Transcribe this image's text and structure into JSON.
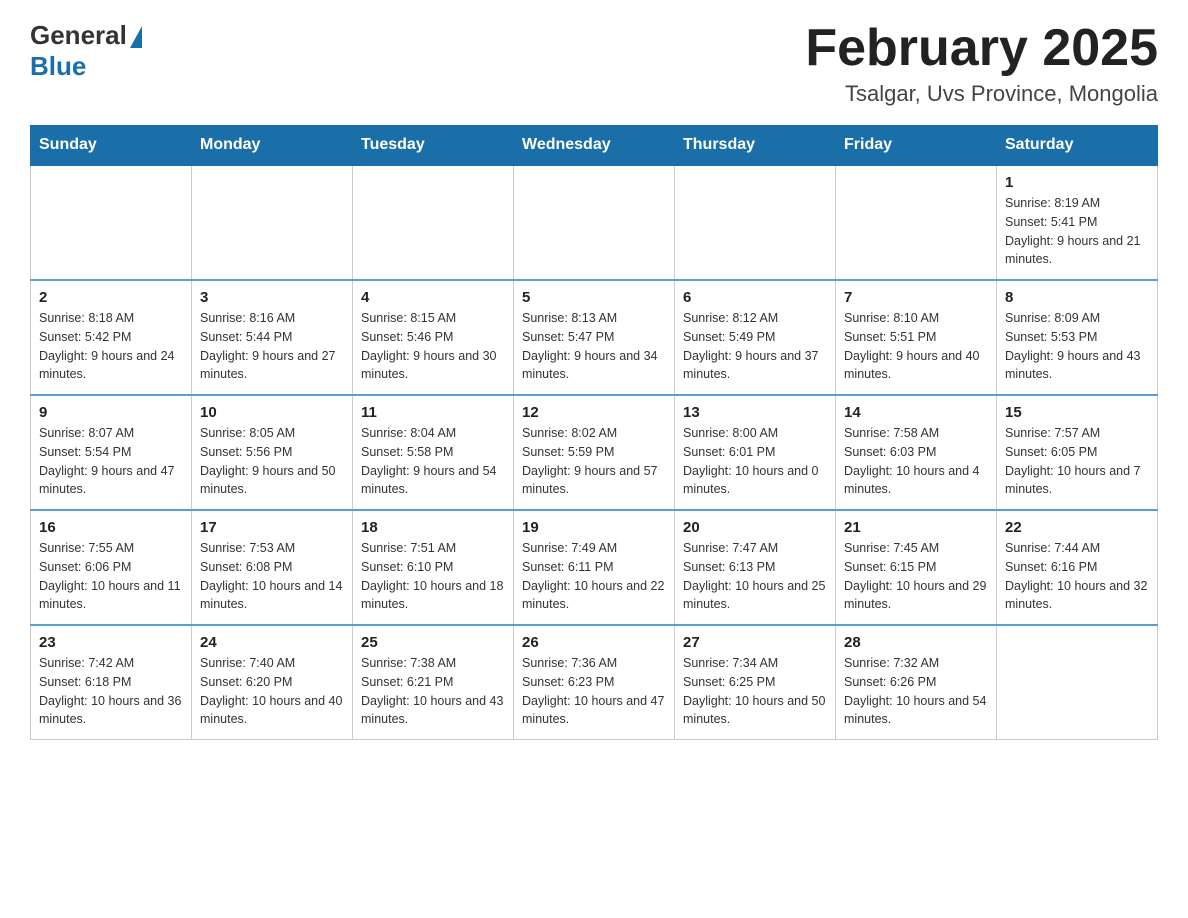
{
  "logo": {
    "general": "General",
    "blue": "Blue"
  },
  "title": {
    "month_year": "February 2025",
    "location": "Tsalgar, Uvs Province, Mongolia"
  },
  "weekdays": [
    "Sunday",
    "Monday",
    "Tuesday",
    "Wednesday",
    "Thursday",
    "Friday",
    "Saturday"
  ],
  "weeks": [
    [
      {
        "day": "",
        "sunrise": "",
        "sunset": "",
        "daylight": ""
      },
      {
        "day": "",
        "sunrise": "",
        "sunset": "",
        "daylight": ""
      },
      {
        "day": "",
        "sunrise": "",
        "sunset": "",
        "daylight": ""
      },
      {
        "day": "",
        "sunrise": "",
        "sunset": "",
        "daylight": ""
      },
      {
        "day": "",
        "sunrise": "",
        "sunset": "",
        "daylight": ""
      },
      {
        "day": "",
        "sunrise": "",
        "sunset": "",
        "daylight": ""
      },
      {
        "day": "1",
        "sunrise": "Sunrise: 8:19 AM",
        "sunset": "Sunset: 5:41 PM",
        "daylight": "Daylight: 9 hours and 21 minutes."
      }
    ],
    [
      {
        "day": "2",
        "sunrise": "Sunrise: 8:18 AM",
        "sunset": "Sunset: 5:42 PM",
        "daylight": "Daylight: 9 hours and 24 minutes."
      },
      {
        "day": "3",
        "sunrise": "Sunrise: 8:16 AM",
        "sunset": "Sunset: 5:44 PM",
        "daylight": "Daylight: 9 hours and 27 minutes."
      },
      {
        "day": "4",
        "sunrise": "Sunrise: 8:15 AM",
        "sunset": "Sunset: 5:46 PM",
        "daylight": "Daylight: 9 hours and 30 minutes."
      },
      {
        "day": "5",
        "sunrise": "Sunrise: 8:13 AM",
        "sunset": "Sunset: 5:47 PM",
        "daylight": "Daylight: 9 hours and 34 minutes."
      },
      {
        "day": "6",
        "sunrise": "Sunrise: 8:12 AM",
        "sunset": "Sunset: 5:49 PM",
        "daylight": "Daylight: 9 hours and 37 minutes."
      },
      {
        "day": "7",
        "sunrise": "Sunrise: 8:10 AM",
        "sunset": "Sunset: 5:51 PM",
        "daylight": "Daylight: 9 hours and 40 minutes."
      },
      {
        "day": "8",
        "sunrise": "Sunrise: 8:09 AM",
        "sunset": "Sunset: 5:53 PM",
        "daylight": "Daylight: 9 hours and 43 minutes."
      }
    ],
    [
      {
        "day": "9",
        "sunrise": "Sunrise: 8:07 AM",
        "sunset": "Sunset: 5:54 PM",
        "daylight": "Daylight: 9 hours and 47 minutes."
      },
      {
        "day": "10",
        "sunrise": "Sunrise: 8:05 AM",
        "sunset": "Sunset: 5:56 PM",
        "daylight": "Daylight: 9 hours and 50 minutes."
      },
      {
        "day": "11",
        "sunrise": "Sunrise: 8:04 AM",
        "sunset": "Sunset: 5:58 PM",
        "daylight": "Daylight: 9 hours and 54 minutes."
      },
      {
        "day": "12",
        "sunrise": "Sunrise: 8:02 AM",
        "sunset": "Sunset: 5:59 PM",
        "daylight": "Daylight: 9 hours and 57 minutes."
      },
      {
        "day": "13",
        "sunrise": "Sunrise: 8:00 AM",
        "sunset": "Sunset: 6:01 PM",
        "daylight": "Daylight: 10 hours and 0 minutes."
      },
      {
        "day": "14",
        "sunrise": "Sunrise: 7:58 AM",
        "sunset": "Sunset: 6:03 PM",
        "daylight": "Daylight: 10 hours and 4 minutes."
      },
      {
        "day": "15",
        "sunrise": "Sunrise: 7:57 AM",
        "sunset": "Sunset: 6:05 PM",
        "daylight": "Daylight: 10 hours and 7 minutes."
      }
    ],
    [
      {
        "day": "16",
        "sunrise": "Sunrise: 7:55 AM",
        "sunset": "Sunset: 6:06 PM",
        "daylight": "Daylight: 10 hours and 11 minutes."
      },
      {
        "day": "17",
        "sunrise": "Sunrise: 7:53 AM",
        "sunset": "Sunset: 6:08 PM",
        "daylight": "Daylight: 10 hours and 14 minutes."
      },
      {
        "day": "18",
        "sunrise": "Sunrise: 7:51 AM",
        "sunset": "Sunset: 6:10 PM",
        "daylight": "Daylight: 10 hours and 18 minutes."
      },
      {
        "day": "19",
        "sunrise": "Sunrise: 7:49 AM",
        "sunset": "Sunset: 6:11 PM",
        "daylight": "Daylight: 10 hours and 22 minutes."
      },
      {
        "day": "20",
        "sunrise": "Sunrise: 7:47 AM",
        "sunset": "Sunset: 6:13 PM",
        "daylight": "Daylight: 10 hours and 25 minutes."
      },
      {
        "day": "21",
        "sunrise": "Sunrise: 7:45 AM",
        "sunset": "Sunset: 6:15 PM",
        "daylight": "Daylight: 10 hours and 29 minutes."
      },
      {
        "day": "22",
        "sunrise": "Sunrise: 7:44 AM",
        "sunset": "Sunset: 6:16 PM",
        "daylight": "Daylight: 10 hours and 32 minutes."
      }
    ],
    [
      {
        "day": "23",
        "sunrise": "Sunrise: 7:42 AM",
        "sunset": "Sunset: 6:18 PM",
        "daylight": "Daylight: 10 hours and 36 minutes."
      },
      {
        "day": "24",
        "sunrise": "Sunrise: 7:40 AM",
        "sunset": "Sunset: 6:20 PM",
        "daylight": "Daylight: 10 hours and 40 minutes."
      },
      {
        "day": "25",
        "sunrise": "Sunrise: 7:38 AM",
        "sunset": "Sunset: 6:21 PM",
        "daylight": "Daylight: 10 hours and 43 minutes."
      },
      {
        "day": "26",
        "sunrise": "Sunrise: 7:36 AM",
        "sunset": "Sunset: 6:23 PM",
        "daylight": "Daylight: 10 hours and 47 minutes."
      },
      {
        "day": "27",
        "sunrise": "Sunrise: 7:34 AM",
        "sunset": "Sunset: 6:25 PM",
        "daylight": "Daylight: 10 hours and 50 minutes."
      },
      {
        "day": "28",
        "sunrise": "Sunrise: 7:32 AM",
        "sunset": "Sunset: 6:26 PM",
        "daylight": "Daylight: 10 hours and 54 minutes."
      },
      {
        "day": "",
        "sunrise": "",
        "sunset": "",
        "daylight": ""
      }
    ]
  ]
}
